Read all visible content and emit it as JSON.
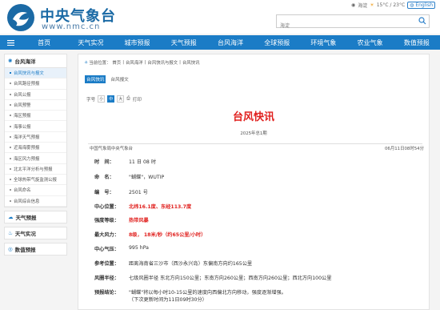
{
  "header": {
    "logo_cn": "中央气象台",
    "logo_en": "www.nmc.cn",
    "location": "海淀",
    "weather": "15°C / 23°C",
    "english_label": "English",
    "search_placeholder": "海淀"
  },
  "nav": {
    "items": [
      "首页",
      "天气实况",
      "城市预报",
      "天气预报",
      "台风海洋",
      "全球预报",
      "环境气象",
      "农业气象",
      "数值预报"
    ]
  },
  "sidebar": {
    "typhoon_title": "台风海洋",
    "items": [
      {
        "label": "台风快讯与报文",
        "active": true
      },
      {
        "label": "台风路径预报",
        "active": false
      },
      {
        "label": "台风公报",
        "active": false
      },
      {
        "label": "台风预警",
        "active": false
      },
      {
        "label": "海区预报",
        "active": false
      },
      {
        "label": "海事公报",
        "active": false
      },
      {
        "label": "海洋天气预报",
        "active": false
      },
      {
        "label": "近海海雾预报",
        "active": false
      },
      {
        "label": "海区风力预报",
        "active": false
      },
      {
        "label": "北太平洋分析与预报",
        "active": false
      },
      {
        "label": "全球热带气旋监测公报",
        "active": false
      },
      {
        "label": "台风命名",
        "active": false
      },
      {
        "label": "台风综合信息",
        "active": false
      }
    ],
    "sections": [
      "天气预报",
      "天气实况",
      "数值预报"
    ]
  },
  "main": {
    "breadcrumb": [
      "当前位置：",
      "首页",
      "台风海洋",
      "台风快讯与报文",
      "台风快讯"
    ],
    "tabs": [
      {
        "label": "台风快讯",
        "active": true
      },
      {
        "label": "台风报文",
        "active": false
      }
    ],
    "font_label": "字号",
    "font_sizes": [
      "小",
      "中",
      "大"
    ],
    "print_label": "打印",
    "title": "台风快讯",
    "issue": "2025年总1期",
    "agency": "中国气象局中央气象台",
    "time": "06月11日08时54分",
    "rows": [
      {
        "key": "时　间：",
        "value": "11 日 08 时",
        "red": false
      },
      {
        "key": "命　名：",
        "value": "\"蝴蝶\"，WUTIP",
        "red": false
      },
      {
        "key": "编　号：",
        "value": "2501 号",
        "red": false
      },
      {
        "key": "中心位置：",
        "value": "北纬16.1度、东经113.7度",
        "red": true
      },
      {
        "key": "强度等级：",
        "value": "热带风暴",
        "red": true
      },
      {
        "key": "最大风力：",
        "value": "8级， 18米/秒（约65公里/小时）",
        "red": true
      },
      {
        "key": "中心气压：",
        "value": "995 hPa",
        "red": false
      },
      {
        "key": "参考位置：",
        "value": "距离海南省三沙市（西沙永兴岛）东偏南方向约165公里",
        "red": false
      },
      {
        "key": "风圈半径：",
        "value": "七级风圈半径 东北方向150公里；东南方向260公里；西南方向260公里；西北方向100公里",
        "red": false
      },
      {
        "key": "预报结论：",
        "value": "\"蝴蝶\"将以每小时10-15公里的速度向西偏北方向移动，强度逐渐增强。",
        "value2": "（下次更新时间为11日09时30分）",
        "red": false
      }
    ]
  }
}
